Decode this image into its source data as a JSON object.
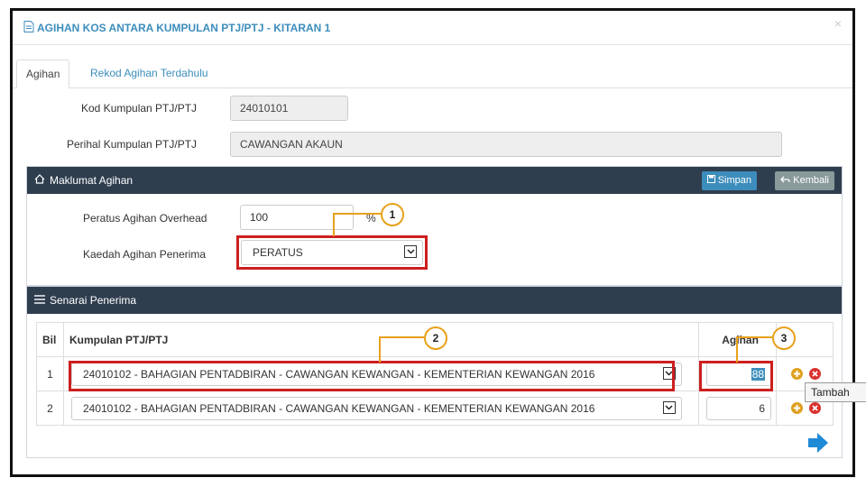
{
  "modal": {
    "title": "AGIHAN KOS ANTARA KUMPULAN PTJ/PTJ - KITARAN 1",
    "close": "×"
  },
  "tabs": [
    {
      "label": "Agihan",
      "active": true
    },
    {
      "label": "Rekod Agihan Terdahulu",
      "active": false
    }
  ],
  "kod": {
    "label": "Kod Kumpulan PTJ/PTJ",
    "value": "24010101"
  },
  "perihal": {
    "label": "Perihal Kumpulan PTJ/PTJ",
    "value": "CAWANGAN AKAUN"
  },
  "maklumat": {
    "title": "Maklumat Agihan",
    "simpan_label": "Simpan",
    "kembali_label": "Kembali",
    "peratus_label": "Peratus Agihan Overhead",
    "peratus_value": "100",
    "peratus_unit": "%",
    "kaedah_label": "Kaedah Agihan Penerima",
    "kaedah_value": "PERATUS"
  },
  "senarai": {
    "title": "Senarai Penerima",
    "columns": {
      "bil": "Bil",
      "kumpulan": "Kumpulan PTJ/PTJ",
      "agihan": "Agihan"
    },
    "rows": [
      {
        "bil": "1",
        "kumpulan": "24010102 - BAHAGIAN PENTADBIRAN - CAWANGAN KEWANGAN - KEMENTERIAN KEWANGAN 2016",
        "agihan": "88"
      },
      {
        "bil": "2",
        "kumpulan": "24010102 - BAHAGIAN PENTADBIRAN - CAWANGAN KEWANGAN - KEMENTERIAN KEWANGAN 2016",
        "agihan": "6"
      }
    ]
  },
  "callouts": [
    "1",
    "2",
    "3"
  ],
  "tooltip": "Tambah",
  "colors": {
    "header": "#2f3e4f",
    "link": "#3c8dbc",
    "highlight": "#cc1f1f",
    "callout": "#e8a11a"
  },
  "icons": [
    "document-icon",
    "home-icon",
    "save-icon",
    "back-arrow-icon",
    "list-icon",
    "chevron-down-icon",
    "plus-circle-icon",
    "remove-circle-icon",
    "next-arrow-icon"
  ]
}
